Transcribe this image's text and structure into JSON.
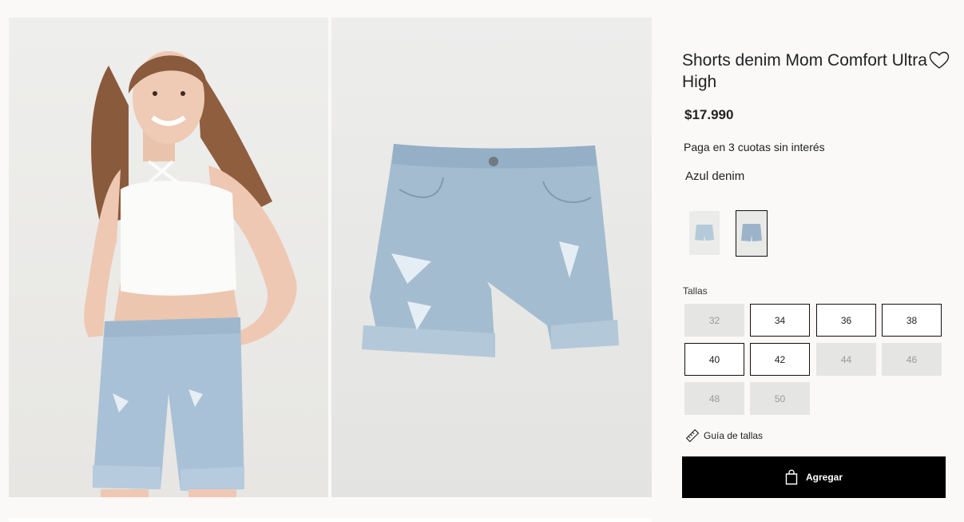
{
  "product": {
    "title": "Shorts denim Mom Comfort Ultra High",
    "price": "$17.990",
    "installments": "Paga en 3 cuotas sin interés",
    "color_name": "Azul denim"
  },
  "sizes": {
    "label": "Tallas",
    "items": [
      {
        "label": "32",
        "available": false
      },
      {
        "label": "34",
        "available": true
      },
      {
        "label": "36",
        "available": true
      },
      {
        "label": "38",
        "available": true
      },
      {
        "label": "40",
        "available": true
      },
      {
        "label": "42",
        "available": true
      },
      {
        "label": "44",
        "available": false
      },
      {
        "label": "46",
        "available": false
      },
      {
        "label": "48",
        "available": false
      },
      {
        "label": "50",
        "available": false
      }
    ]
  },
  "size_guide": {
    "label": "Guía de tallas",
    "icon": "ruler-icon"
  },
  "add_button": {
    "label": "Agregar",
    "icon": "shopping-bag-icon"
  },
  "favorite": {
    "icon": "heart-icon"
  },
  "colors": {
    "button_bg": "#000000",
    "unavailable_bg": "#e5e5e3",
    "denim": "#a9c1d6"
  }
}
